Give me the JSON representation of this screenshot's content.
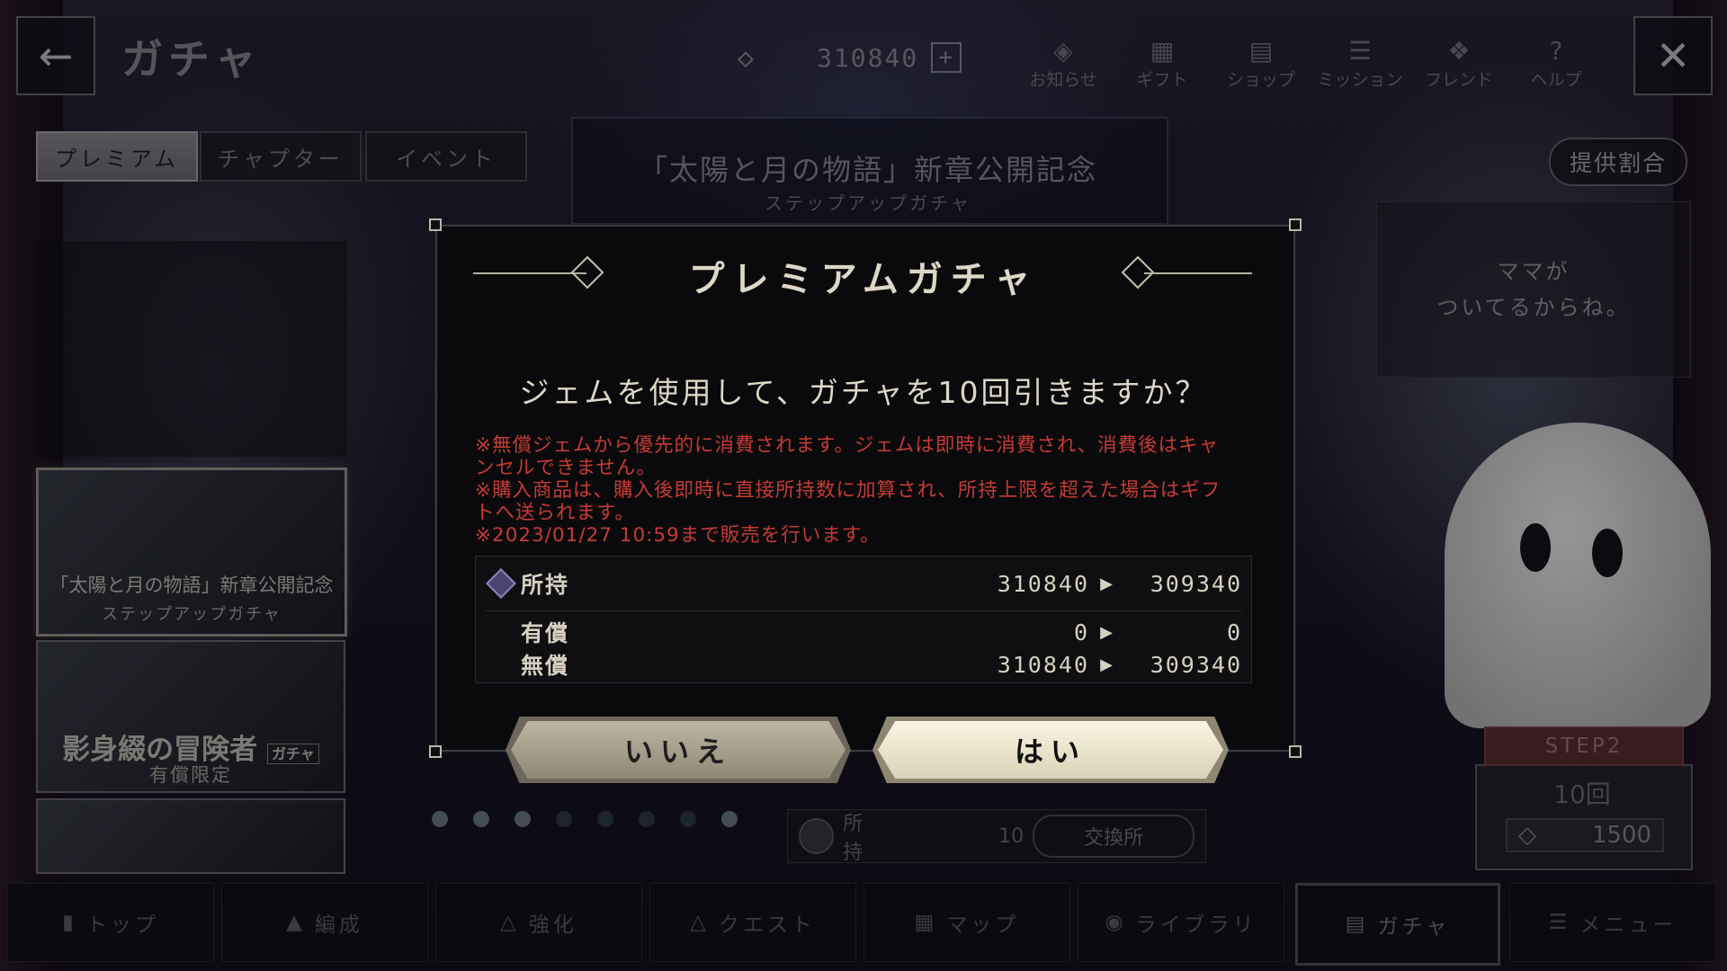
{
  "header": {
    "title": "ガチャ",
    "gem_count": "310840",
    "nav": [
      {
        "label": "お知らせ",
        "icon": "diamond-icon"
      },
      {
        "label": "ギフト",
        "icon": "gift-icon"
      },
      {
        "label": "ショップ",
        "icon": "shop-icon"
      },
      {
        "label": "ミッション",
        "icon": "list-icon"
      },
      {
        "label": "フレンド",
        "icon": "friend-icon"
      },
      {
        "label": "ヘルプ",
        "icon": "help-icon"
      }
    ]
  },
  "tabs": [
    "プレミアム",
    "チャプター",
    "イベント"
  ],
  "rates_button": "提供割合",
  "banner": {
    "title": "「太陽と月の物語」新章公開記念",
    "subtitle": "ステップアップガチャ"
  },
  "speech_lines": [
    "ママが",
    "ついてるからね。"
  ],
  "cards": [
    {
      "title": "「太陽と月の物語」新章公開記念",
      "sub": "ステップアップガチャ"
    },
    {
      "title": "影身綴の冒険者",
      "tag": "ガチャ",
      "sub": "有償限定"
    }
  ],
  "step": {
    "label": "STEP2",
    "count": "10回",
    "cost": "1500"
  },
  "owned": {
    "label": "所持",
    "value": "10",
    "exchange": "交換所"
  },
  "bottom_nav": [
    "トップ",
    "編成",
    "強化",
    "クエスト",
    "マップ",
    "ライブラリ",
    "ガチャ",
    "メニュー"
  ],
  "modal": {
    "title": "プレミアムガチャ",
    "question": "ジェムを使用して、ガチャを10回引きますか？",
    "notes": [
      "※無償ジェムから優先的に消費されます。ジェムは即時に消費され、消費後はキャ",
      "ンセルできません。",
      "※購入商品は、購入後即時に直接所持数に加算され、所持上限を超えた場合はギフ",
      "トへ送られます。",
      "※2023/01/27 10:59まで販売を行います。"
    ],
    "rows": [
      {
        "label": "所持",
        "from": "310840",
        "to": "309340"
      },
      {
        "label": "有償",
        "from": "0",
        "to": "0"
      },
      {
        "label": "無償",
        "from": "310840",
        "to": "309340"
      }
    ],
    "no_button": "いいえ",
    "yes_button": "はい"
  }
}
